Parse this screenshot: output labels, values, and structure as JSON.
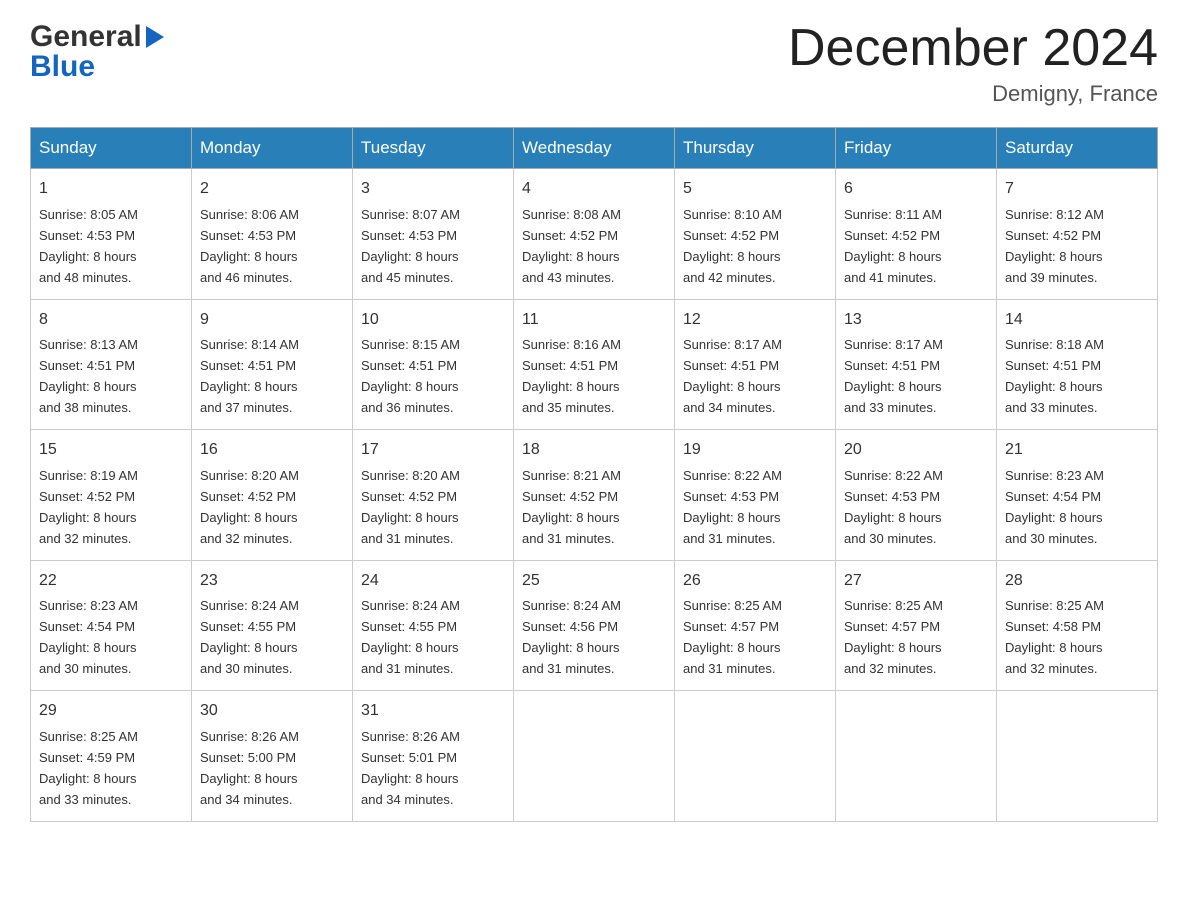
{
  "header": {
    "logo_general": "General",
    "logo_blue": "Blue",
    "month_title": "December 2024",
    "location": "Demigny, France"
  },
  "weekdays": [
    "Sunday",
    "Monday",
    "Tuesday",
    "Wednesday",
    "Thursday",
    "Friday",
    "Saturday"
  ],
  "weeks": [
    [
      {
        "day": "1",
        "sunrise": "Sunrise: 8:05 AM",
        "sunset": "Sunset: 4:53 PM",
        "daylight": "Daylight: 8 hours",
        "daylight2": "and 48 minutes."
      },
      {
        "day": "2",
        "sunrise": "Sunrise: 8:06 AM",
        "sunset": "Sunset: 4:53 PM",
        "daylight": "Daylight: 8 hours",
        "daylight2": "and 46 minutes."
      },
      {
        "day": "3",
        "sunrise": "Sunrise: 8:07 AM",
        "sunset": "Sunset: 4:53 PM",
        "daylight": "Daylight: 8 hours",
        "daylight2": "and 45 minutes."
      },
      {
        "day": "4",
        "sunrise": "Sunrise: 8:08 AM",
        "sunset": "Sunset: 4:52 PM",
        "daylight": "Daylight: 8 hours",
        "daylight2": "and 43 minutes."
      },
      {
        "day": "5",
        "sunrise": "Sunrise: 8:10 AM",
        "sunset": "Sunset: 4:52 PM",
        "daylight": "Daylight: 8 hours",
        "daylight2": "and 42 minutes."
      },
      {
        "day": "6",
        "sunrise": "Sunrise: 8:11 AM",
        "sunset": "Sunset: 4:52 PM",
        "daylight": "Daylight: 8 hours",
        "daylight2": "and 41 minutes."
      },
      {
        "day": "7",
        "sunrise": "Sunrise: 8:12 AM",
        "sunset": "Sunset: 4:52 PM",
        "daylight": "Daylight: 8 hours",
        "daylight2": "and 39 minutes."
      }
    ],
    [
      {
        "day": "8",
        "sunrise": "Sunrise: 8:13 AM",
        "sunset": "Sunset: 4:51 PM",
        "daylight": "Daylight: 8 hours",
        "daylight2": "and 38 minutes."
      },
      {
        "day": "9",
        "sunrise": "Sunrise: 8:14 AM",
        "sunset": "Sunset: 4:51 PM",
        "daylight": "Daylight: 8 hours",
        "daylight2": "and 37 minutes."
      },
      {
        "day": "10",
        "sunrise": "Sunrise: 8:15 AM",
        "sunset": "Sunset: 4:51 PM",
        "daylight": "Daylight: 8 hours",
        "daylight2": "and 36 minutes."
      },
      {
        "day": "11",
        "sunrise": "Sunrise: 8:16 AM",
        "sunset": "Sunset: 4:51 PM",
        "daylight": "Daylight: 8 hours",
        "daylight2": "and 35 minutes."
      },
      {
        "day": "12",
        "sunrise": "Sunrise: 8:17 AM",
        "sunset": "Sunset: 4:51 PM",
        "daylight": "Daylight: 8 hours",
        "daylight2": "and 34 minutes."
      },
      {
        "day": "13",
        "sunrise": "Sunrise: 8:17 AM",
        "sunset": "Sunset: 4:51 PM",
        "daylight": "Daylight: 8 hours",
        "daylight2": "and 33 minutes."
      },
      {
        "day": "14",
        "sunrise": "Sunrise: 8:18 AM",
        "sunset": "Sunset: 4:51 PM",
        "daylight": "Daylight: 8 hours",
        "daylight2": "and 33 minutes."
      }
    ],
    [
      {
        "day": "15",
        "sunrise": "Sunrise: 8:19 AM",
        "sunset": "Sunset: 4:52 PM",
        "daylight": "Daylight: 8 hours",
        "daylight2": "and 32 minutes."
      },
      {
        "day": "16",
        "sunrise": "Sunrise: 8:20 AM",
        "sunset": "Sunset: 4:52 PM",
        "daylight": "Daylight: 8 hours",
        "daylight2": "and 32 minutes."
      },
      {
        "day": "17",
        "sunrise": "Sunrise: 8:20 AM",
        "sunset": "Sunset: 4:52 PM",
        "daylight": "Daylight: 8 hours",
        "daylight2": "and 31 minutes."
      },
      {
        "day": "18",
        "sunrise": "Sunrise: 8:21 AM",
        "sunset": "Sunset: 4:52 PM",
        "daylight": "Daylight: 8 hours",
        "daylight2": "and 31 minutes."
      },
      {
        "day": "19",
        "sunrise": "Sunrise: 8:22 AM",
        "sunset": "Sunset: 4:53 PM",
        "daylight": "Daylight: 8 hours",
        "daylight2": "and 31 minutes."
      },
      {
        "day": "20",
        "sunrise": "Sunrise: 8:22 AM",
        "sunset": "Sunset: 4:53 PM",
        "daylight": "Daylight: 8 hours",
        "daylight2": "and 30 minutes."
      },
      {
        "day": "21",
        "sunrise": "Sunrise: 8:23 AM",
        "sunset": "Sunset: 4:54 PM",
        "daylight": "Daylight: 8 hours",
        "daylight2": "and 30 minutes."
      }
    ],
    [
      {
        "day": "22",
        "sunrise": "Sunrise: 8:23 AM",
        "sunset": "Sunset: 4:54 PM",
        "daylight": "Daylight: 8 hours",
        "daylight2": "and 30 minutes."
      },
      {
        "day": "23",
        "sunrise": "Sunrise: 8:24 AM",
        "sunset": "Sunset: 4:55 PM",
        "daylight": "Daylight: 8 hours",
        "daylight2": "and 30 minutes."
      },
      {
        "day": "24",
        "sunrise": "Sunrise: 8:24 AM",
        "sunset": "Sunset: 4:55 PM",
        "daylight": "Daylight: 8 hours",
        "daylight2": "and 31 minutes."
      },
      {
        "day": "25",
        "sunrise": "Sunrise: 8:24 AM",
        "sunset": "Sunset: 4:56 PM",
        "daylight": "Daylight: 8 hours",
        "daylight2": "and 31 minutes."
      },
      {
        "day": "26",
        "sunrise": "Sunrise: 8:25 AM",
        "sunset": "Sunset: 4:57 PM",
        "daylight": "Daylight: 8 hours",
        "daylight2": "and 31 minutes."
      },
      {
        "day": "27",
        "sunrise": "Sunrise: 8:25 AM",
        "sunset": "Sunset: 4:57 PM",
        "daylight": "Daylight: 8 hours",
        "daylight2": "and 32 minutes."
      },
      {
        "day": "28",
        "sunrise": "Sunrise: 8:25 AM",
        "sunset": "Sunset: 4:58 PM",
        "daylight": "Daylight: 8 hours",
        "daylight2": "and 32 minutes."
      }
    ],
    [
      {
        "day": "29",
        "sunrise": "Sunrise: 8:25 AM",
        "sunset": "Sunset: 4:59 PM",
        "daylight": "Daylight: 8 hours",
        "daylight2": "and 33 minutes."
      },
      {
        "day": "30",
        "sunrise": "Sunrise: 8:26 AM",
        "sunset": "Sunset: 5:00 PM",
        "daylight": "Daylight: 8 hours",
        "daylight2": "and 34 minutes."
      },
      {
        "day": "31",
        "sunrise": "Sunrise: 8:26 AM",
        "sunset": "Sunset: 5:01 PM",
        "daylight": "Daylight: 8 hours",
        "daylight2": "and 34 minutes."
      },
      null,
      null,
      null,
      null
    ]
  ]
}
